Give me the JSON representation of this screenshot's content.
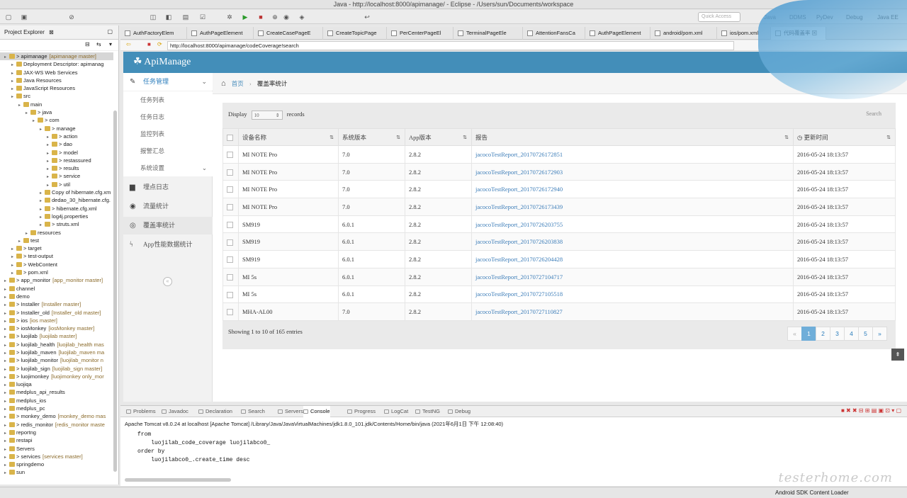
{
  "window": {
    "title": "Java - http://localhost:8000/apimanage/ - Eclipse - /Users/sun/Documents/workspace"
  },
  "toolbar": {
    "quick_access_placeholder": "Quick Access",
    "perspectives": [
      "Java",
      "DDMS",
      "PyDev",
      "Debug",
      "Java EE"
    ]
  },
  "project_explorer": {
    "title": "Project Explorer",
    "tree": [
      {
        "label": "> apimanage",
        "decoration": "[apimanage master]",
        "depth": 0,
        "selected": true
      },
      {
        "label": "Deployment Descriptor: apimanag",
        "depth": 1
      },
      {
        "label": "JAX-WS Web Services",
        "depth": 1
      },
      {
        "label": "Java Resources",
        "depth": 1
      },
      {
        "label": "JavaScript Resources",
        "depth": 1
      },
      {
        "label": "src",
        "depth": 1
      },
      {
        "label": "main",
        "depth": 2
      },
      {
        "label": "> java",
        "depth": 3
      },
      {
        "label": "> com",
        "depth": 4
      },
      {
        "label": "> manage",
        "depth": 5
      },
      {
        "label": "> action",
        "depth": 6
      },
      {
        "label": "> dao",
        "depth": 6
      },
      {
        "label": "> model",
        "depth": 6
      },
      {
        "label": "> restassured",
        "depth": 6
      },
      {
        "label": "> results",
        "depth": 6
      },
      {
        "label": "> service",
        "depth": 6
      },
      {
        "label": "> util",
        "depth": 6
      },
      {
        "label": "Copy of hibernate.cfg.xm",
        "depth": 5
      },
      {
        "label": "dedao_30_hibernate.cfg.",
        "depth": 5
      },
      {
        "label": "> hibernate.cfg.xml",
        "depth": 5
      },
      {
        "label": "log4j.properties",
        "depth": 5
      },
      {
        "label": "> struts.xml",
        "depth": 5
      },
      {
        "label": "resources",
        "depth": 3
      },
      {
        "label": "test",
        "depth": 2
      },
      {
        "label": "> target",
        "depth": 1
      },
      {
        "label": "> test-output",
        "depth": 1
      },
      {
        "label": "> WebContent",
        "depth": 1
      },
      {
        "label": "> pom.xml",
        "depth": 1
      },
      {
        "label": "> app_monitor",
        "decoration": "[app_monitor master]",
        "depth": 0
      },
      {
        "label": "channel",
        "depth": 0
      },
      {
        "label": "demo",
        "depth": 0
      },
      {
        "label": "> Installer",
        "decoration": "[Installer master]",
        "depth": 0
      },
      {
        "label": "> Installer_old",
        "decoration": "[Installer_old master]",
        "depth": 0
      },
      {
        "label": "> ios",
        "decoration": "[ios master]",
        "depth": 0
      },
      {
        "label": "> iosMonkey",
        "decoration": "[iosMonkey master]",
        "depth": 0
      },
      {
        "label": "> luojilab",
        "decoration": "[luojilab master]",
        "depth": 0
      },
      {
        "label": "> luojilab_health",
        "decoration": "[luojilab_health mas",
        "depth": 0
      },
      {
        "label": "> luojilab_maven",
        "decoration": "[luojilab_maven ma",
        "depth": 0
      },
      {
        "label": "> luojilab_monitor",
        "decoration": "[luojilab_monitor n",
        "depth": 0
      },
      {
        "label": "> luojilab_sign",
        "decoration": "[luojilab_sign master]",
        "depth": 0
      },
      {
        "label": "> luojimonkey",
        "decoration": "[luojimonkey only_mor",
        "depth": 0
      },
      {
        "label": "luojiqa",
        "depth": 0
      },
      {
        "label": "medplus_api_results",
        "depth": 0
      },
      {
        "label": "medplus_ios",
        "depth": 0
      },
      {
        "label": "medplus_pc",
        "depth": 0
      },
      {
        "label": "> monkey_demo",
        "decoration": "[monkey_demo mas",
        "depth": 0
      },
      {
        "label": "> redis_monitor",
        "decoration": "[redis_monitor maste",
        "depth": 0
      },
      {
        "label": "reportng",
        "depth": 0
      },
      {
        "label": "restapi",
        "depth": 0
      },
      {
        "label": "Servers",
        "depth": 0
      },
      {
        "label": "> services",
        "decoration": "[services master]",
        "depth": 0
      },
      {
        "label": "springdemo",
        "depth": 0
      },
      {
        "label": "sun",
        "depth": 0
      }
    ]
  },
  "editor_tabs": [
    "AuthFactoryElem",
    "AuthPageElement",
    "CreateCasePageE",
    "CreateTopicPage",
    "PerCenterPageEl",
    "TerminalPageEle",
    "AttentionFansCa",
    "AuthPageElement",
    "android/pom.xml",
    "ios/pom.xml",
    "代码覆盖率"
  ],
  "browser": {
    "url": "http://localhost:8000/apimanage/codeCoverage!search"
  },
  "app": {
    "brand": "ApiManage",
    "sidebar": {
      "task_mgmt": "任务管理",
      "sub": [
        "任务列表",
        "任务日志",
        "监控列表",
        "报警汇总",
        "系统设置"
      ],
      "items": [
        "埋点日志",
        "流量统计",
        "覆盖率统计",
        "App性能数据统计"
      ]
    },
    "breadcrumb": {
      "home": "首页",
      "current": "覆盖率统计"
    },
    "display": {
      "prefix": "Display",
      "value": "10",
      "suffix": "records"
    },
    "search_label": "Search",
    "table": {
      "headers": [
        "设备名称",
        "系统版本",
        "App版本",
        "报告",
        "更新时间"
      ],
      "rows": [
        [
          "MI NOTE Pro",
          "7.0",
          "2.8.2",
          "jacocoTestReport_20170726172851",
          "2016-05-24 18:13:57"
        ],
        [
          "MI NOTE Pro",
          "7.0",
          "2.8.2",
          "jacocoTestReport_20170726172903",
          "2016-05-24 18:13:57"
        ],
        [
          "MI NOTE Pro",
          "7.0",
          "2.8.2",
          "jacocoTestReport_20170726172940",
          "2016-05-24 18:13:57"
        ],
        [
          "MI NOTE Pro",
          "7.0",
          "2.8.2",
          "jacocoTestReport_20170726173439",
          "2016-05-24 18:13:57"
        ],
        [
          "SM919",
          "6.0.1",
          "2.8.2",
          "jacocoTestReport_20170726203755",
          "2016-05-24 18:13:57"
        ],
        [
          "SM919",
          "6.0.1",
          "2.8.2",
          "jacocoTestReport_20170726203838",
          "2016-05-24 18:13:57"
        ],
        [
          "SM919",
          "6.0.1",
          "2.8.2",
          "jacocoTestReport_20170726204428",
          "2016-05-24 18:13:57"
        ],
        [
          "MI 5s",
          "6.0.1",
          "2.8.2",
          "jacocoTestReport_20170727104717",
          "2016-05-24 18:13:57"
        ],
        [
          "MI 5s",
          "6.0.1",
          "2.8.2",
          "jacocoTestReport_20170727105518",
          "2016-05-24 18:13:57"
        ],
        [
          "MHA-AL00",
          "7.0",
          "2.8.2",
          "jacocoTestReport_20170727110827",
          "2016-05-24 18:13:57"
        ]
      ]
    },
    "showing": "Showing 1 to 10 of 165 entries",
    "pager": [
      "«",
      "1",
      "2",
      "3",
      "4",
      "5",
      "»"
    ]
  },
  "bottom_tabs": [
    "Problems",
    "Javadoc",
    "Declaration",
    "Search",
    "Servers",
    "Console",
    "Progress",
    "LogCat",
    "TestNG",
    "Debug"
  ],
  "console": {
    "header": "Apache Tomcat v8.0.24 at localhost [Apache Tomcat] /Library/Java/JavaVirtualMachines/jdk1.8.0_101.jdk/Contents/Home/bin/java (2021年6月1日 下午 12:08:40)",
    "lines": [
      "from",
      "    luojilab_code_coverage luojilabco0_",
      "order by",
      "    luojilabco0_.create_time desc"
    ]
  },
  "status": {
    "text": "Android SDK Content Loader"
  },
  "watermark": "testerhome.com"
}
